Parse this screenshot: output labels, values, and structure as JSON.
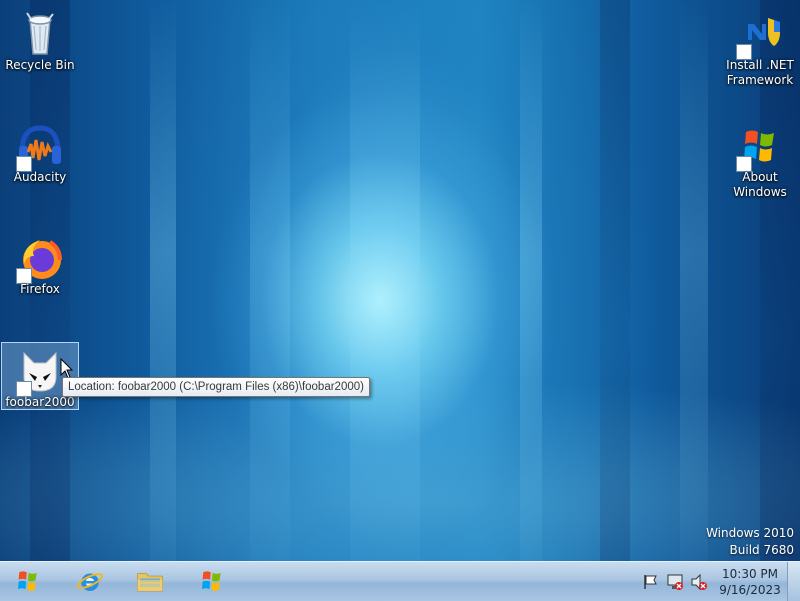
{
  "desktop": {
    "icons": [
      {
        "label": "Recycle Bin",
        "icon": "recycle-bin-icon"
      },
      {
        "label": "Audacity",
        "icon": "audacity-icon"
      },
      {
        "label": "Firefox",
        "icon": "firefox-icon"
      },
      {
        "label": "foobar2000",
        "icon": "foobar2000-icon"
      },
      {
        "label": "Install .NET\nFramework",
        "icon": "dotnet-installer-icon"
      },
      {
        "label": "About\nWindows",
        "icon": "windows-logo-icon"
      }
    ],
    "tooltip": "Location: foobar2000 (C:\\Program Files (x86)\\foobar2000)"
  },
  "watermark": {
    "line1": "Windows 2010",
    "line2": "Build 7680"
  },
  "taskbar": {
    "pinned": [
      {
        "name": "start",
        "icon": "windows-logo-icon"
      },
      {
        "name": "internet-explorer",
        "icon": "internet-explorer-icon"
      },
      {
        "name": "file-explorer",
        "icon": "folder-icon"
      },
      {
        "name": "windows",
        "icon": "windows-logo-icon"
      }
    ],
    "tray_icons": [
      "action-center-flag-icon",
      "network-icon",
      "volume-muted-icon"
    ],
    "clock": {
      "time": "10:30 PM",
      "date": "9/16/2023"
    }
  },
  "colors": {
    "desktop_accent": "#1d84c0",
    "taskbar": "#aac6e3"
  }
}
